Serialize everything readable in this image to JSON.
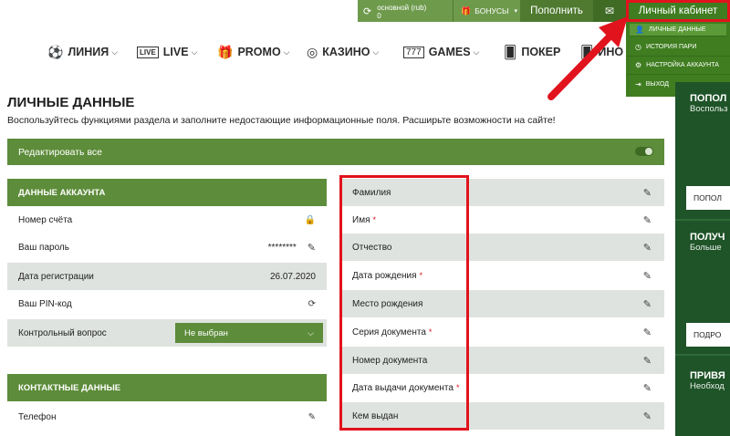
{
  "topbar": {
    "account_line1": "основной (rub)",
    "account_line2": "0",
    "bonus_label": "БОНУСЫ",
    "topup_label": "Пополнить",
    "cabinet_label": "Личный кабинет"
  },
  "nav": {
    "items": [
      {
        "label": "ЛИНИЯ",
        "icon": "soccer-ball-icon"
      },
      {
        "label": "LIVE",
        "icon": "live-icon"
      },
      {
        "label": "PROMO",
        "icon": "gift-icon"
      },
      {
        "label": "КАЗИНО",
        "icon": "chip-icon"
      },
      {
        "label": "GAMES",
        "icon": "slots-icon"
      },
      {
        "label": "ПОКЕР",
        "icon": "cards-icon"
      },
      {
        "label": "ИНО",
        "icon": "cards-icon"
      }
    ],
    "live_badge": "LIVE"
  },
  "dropdown": {
    "items": [
      {
        "label": "ЛИЧНЫЕ ДАННЫЕ",
        "icon": "user-icon"
      },
      {
        "label": "ИСТОРИЯ ПАРИ",
        "icon": "clock-icon"
      },
      {
        "label": "НАСТРОЙКА АККАУНТА",
        "icon": "gears-icon"
      },
      {
        "label": "ВЫХОД",
        "icon": "logout-icon"
      }
    ]
  },
  "page": {
    "title": "ЛИЧНЫЕ ДАННЫЕ",
    "subtitle": "Воспользуйтесь функциями раздела и заполните недостающие информационные поля. Расширьте возможности на сайте!",
    "edit_all_label": "Редактировать все"
  },
  "account": {
    "heading": "ДАННЫЕ АККАУНТА",
    "account_number_label": "Номер счёта",
    "password_label": "Ваш пароль",
    "password_value": "********",
    "reg_date_label": "Дата регистрации",
    "reg_date_value": "26.07.2020",
    "pin_label": "Ваш PIN-код",
    "question_label": "Контрольный вопрос",
    "question_value": "Не выбран"
  },
  "contacts": {
    "heading": "КОНТАКТНЫЕ ДАННЫЕ",
    "phone_label": "Телефон"
  },
  "personal_fields": [
    {
      "label": "Фамилия",
      "required": false
    },
    {
      "label": "Имя",
      "required": true
    },
    {
      "label": "Отчество",
      "required": false
    },
    {
      "label": "Дата рождения",
      "required": true
    },
    {
      "label": "Место рождения",
      "required": false
    },
    {
      "label": "Серия документа",
      "required": true
    },
    {
      "label": "Номер документа",
      "required": false
    },
    {
      "label": "Дата выдачи документа",
      "required": true
    },
    {
      "label": "Кем выдан",
      "required": false
    }
  ],
  "required_mark": "*",
  "sidebar": {
    "block1_title": "ПОПОЛ",
    "block1_sub": "Воспольз",
    "block1_btn": "ПОПОЛ",
    "block2_title": "ПОЛУЧ",
    "block2_sub": "Больше",
    "block2_btn": "ПОДРО",
    "block3_title": "ПРИВЯ",
    "block3_sub": "Необход"
  },
  "colors": {
    "brand_green": "#5d8c3a",
    "dark_green": "#1f5328",
    "highlight_red": "#e1131d",
    "row_shade": "#dfe3df"
  }
}
